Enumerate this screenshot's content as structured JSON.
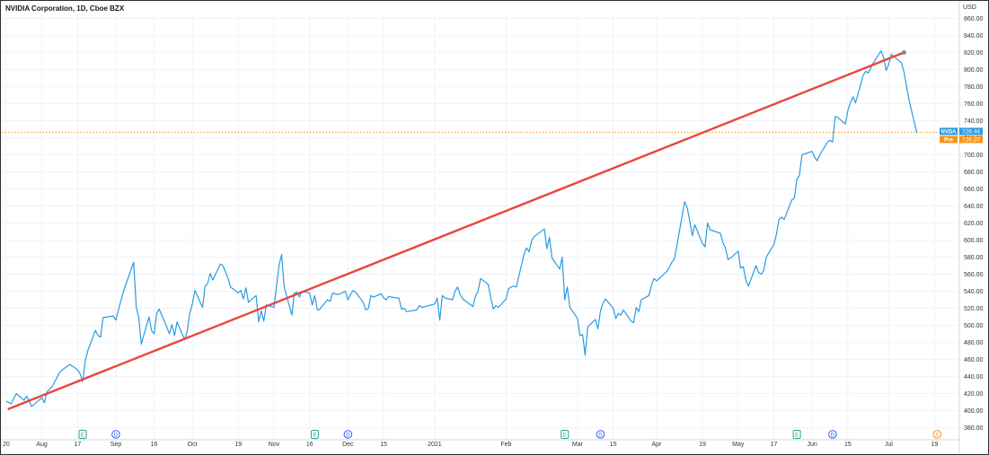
{
  "chart_title": "NVIDIA Corporation, 1D, Cboe BZX",
  "currency": "USD",
  "colors": {
    "price_line": "#2a9be0",
    "trend_line": "#e8453c",
    "last_tag": "#2a9be0",
    "pre_tag": "#f7931a",
    "hline": "#f7931a",
    "grid": "#f0f3f9"
  },
  "price_tags": [
    {
      "symbol": "NVDA",
      "value": "726.44"
    },
    {
      "symbol": "Pre",
      "value": "726.20"
    }
  ],
  "event_markers": [
    {
      "letter": "E",
      "color": "#26a69a",
      "date": "2020-08-19"
    },
    {
      "letter": "D",
      "color": "#2962ff",
      "date": "2020-09-01"
    },
    {
      "letter": "E",
      "color": "#26a69a",
      "date": "2020-11-18"
    },
    {
      "letter": "D",
      "color": "#2962ff",
      "date": "2020-12-01"
    },
    {
      "letter": "E",
      "color": "#26a69a",
      "date": "2021-02-24"
    },
    {
      "letter": "D",
      "color": "#2962ff",
      "date": "2021-03-10"
    },
    {
      "letter": "E",
      "color": "#26a69a",
      "date": "2021-05-26"
    },
    {
      "letter": "D",
      "color": "#2962ff",
      "date": "2021-06-09"
    },
    {
      "letter": "S",
      "color": "#f7931a",
      "date": "2021-07-20"
    }
  ],
  "chart_data": {
    "type": "line",
    "title": "NVIDIA Corporation, 1D, Cboe BZX",
    "ylabel": "USD",
    "ylim": [
      380,
      860
    ],
    "xlim": [
      "2020-07-19",
      "2021-07-28"
    ],
    "grid": true,
    "y_ticks": [
      "380.00",
      "400.00",
      "420.00",
      "440.00",
      "460.00",
      "480.00",
      "500.00",
      "520.00",
      "540.00",
      "560.00",
      "580.00",
      "600.00",
      "620.00",
      "640.00",
      "660.00",
      "680.00",
      "700.00",
      "720.00",
      "740.00",
      "760.00",
      "780.00",
      "800.00",
      "820.00",
      "840.00",
      "860.00"
    ],
    "x_ticks": [
      {
        "label": "20",
        "date": "2020-07-20"
      },
      {
        "label": "Aug",
        "date": "2020-08-03"
      },
      {
        "label": "17",
        "date": "2020-08-17"
      },
      {
        "label": "Sep",
        "date": "2020-09-01"
      },
      {
        "label": "16",
        "date": "2020-09-16"
      },
      {
        "label": "Oct",
        "date": "2020-10-01"
      },
      {
        "label": "19",
        "date": "2020-10-19"
      },
      {
        "label": "Nov",
        "date": "2020-11-02"
      },
      {
        "label": "16",
        "date": "2020-11-16"
      },
      {
        "label": "Dec",
        "date": "2020-12-01"
      },
      {
        "label": "15",
        "date": "2020-12-15"
      },
      {
        "label": "2021",
        "date": "2021-01-04"
      },
      {
        "label": "Feb",
        "date": "2021-02-01"
      },
      {
        "label": "Mar",
        "date": "2021-03-01"
      },
      {
        "label": "15",
        "date": "2021-03-15"
      },
      {
        "label": "Apr",
        "date": "2021-04-01"
      },
      {
        "label": "19",
        "date": "2021-04-19"
      },
      {
        "label": "May",
        "date": "2021-05-03"
      },
      {
        "label": "17",
        "date": "2021-05-17"
      },
      {
        "label": "Jun",
        "date": "2021-06-01"
      },
      {
        "label": "15",
        "date": "2021-06-15"
      },
      {
        "label": "Jul",
        "date": "2021-07-01"
      },
      {
        "label": "19",
        "date": "2021-07-19"
      }
    ],
    "series": [
      {
        "values": [
          [
            "2020-07-20",
            411
          ],
          [
            "2020-07-22",
            408
          ],
          [
            "2020-07-24",
            420
          ],
          [
            "2020-07-27",
            412
          ],
          [
            "2020-07-28",
            417
          ],
          [
            "2020-07-30",
            405
          ],
          [
            "2020-08-03",
            415
          ],
          [
            "2020-08-04",
            409
          ],
          [
            "2020-08-05",
            422
          ],
          [
            "2020-08-07",
            428
          ],
          [
            "2020-08-10",
            445
          ],
          [
            "2020-08-12",
            450
          ],
          [
            "2020-08-14",
            454
          ],
          [
            "2020-08-17",
            448
          ],
          [
            "2020-08-18",
            443
          ],
          [
            "2020-08-19",
            434
          ],
          [
            "2020-08-20",
            458
          ],
          [
            "2020-08-21",
            470
          ],
          [
            "2020-08-24",
            494
          ],
          [
            "2020-08-25",
            488
          ],
          [
            "2020-08-26",
            486
          ],
          [
            "2020-08-27",
            509
          ],
          [
            "2020-08-31",
            511
          ],
          [
            "2020-09-01",
            506
          ],
          [
            "2020-09-03",
            529
          ],
          [
            "2020-09-04",
            540
          ],
          [
            "2020-09-08",
            574
          ],
          [
            "2020-09-09",
            521
          ],
          [
            "2020-09-10",
            509
          ],
          [
            "2020-09-11",
            478
          ],
          [
            "2020-09-14",
            510
          ],
          [
            "2020-09-15",
            494
          ],
          [
            "2020-09-16",
            490
          ],
          [
            "2020-09-17",
            514
          ],
          [
            "2020-09-18",
            519
          ],
          [
            "2020-09-21",
            498
          ],
          [
            "2020-09-22",
            490
          ],
          [
            "2020-09-23",
            501
          ],
          [
            "2020-09-24",
            488
          ],
          [
            "2020-09-25",
            504
          ],
          [
            "2020-09-28",
            483
          ],
          [
            "2020-09-29",
            493
          ],
          [
            "2020-09-30",
            514
          ],
          [
            "2020-10-01",
            525
          ],
          [
            "2020-10-02",
            541
          ],
          [
            "2020-10-05",
            521
          ],
          [
            "2020-10-06",
            546
          ],
          [
            "2020-10-07",
            549
          ],
          [
            "2020-10-08",
            561
          ],
          [
            "2020-10-09",
            553
          ],
          [
            "2020-10-12",
            572
          ],
          [
            "2020-10-13",
            570
          ],
          [
            "2020-10-14",
            563
          ],
          [
            "2020-10-15",
            555
          ],
          [
            "2020-10-16",
            545
          ],
          [
            "2020-10-19",
            538
          ],
          [
            "2020-10-20",
            541
          ],
          [
            "2020-10-21",
            531
          ],
          [
            "2020-10-22",
            544
          ],
          [
            "2020-10-23",
            527
          ],
          [
            "2020-10-26",
            535
          ],
          [
            "2020-10-27",
            504
          ],
          [
            "2020-10-28",
            517
          ],
          [
            "2020-10-29",
            505
          ],
          [
            "2020-10-30",
            524
          ],
          [
            "2020-11-02",
            521
          ],
          [
            "2020-11-04",
            571
          ],
          [
            "2020-11-05",
            583
          ],
          [
            "2020-11-06",
            545
          ],
          [
            "2020-11-09",
            512
          ],
          [
            "2020-11-10",
            538
          ],
          [
            "2020-11-11",
            539
          ],
          [
            "2020-11-12",
            533
          ],
          [
            "2020-11-13",
            540
          ],
          [
            "2020-11-16",
            538
          ],
          [
            "2020-11-17",
            524
          ],
          [
            "2020-11-18",
            535
          ],
          [
            "2020-11-19",
            518
          ],
          [
            "2020-11-20",
            519
          ],
          [
            "2020-11-23",
            530
          ],
          [
            "2020-11-24",
            528
          ],
          [
            "2020-11-25",
            538
          ],
          [
            "2020-11-27",
            536
          ],
          [
            "2020-11-30",
            540
          ],
          [
            "2020-12-01",
            530
          ],
          [
            "2020-12-02",
            536
          ],
          [
            "2020-12-03",
            541
          ],
          [
            "2020-12-04",
            539
          ],
          [
            "2020-12-07",
            527
          ],
          [
            "2020-12-08",
            518
          ],
          [
            "2020-12-09",
            520
          ],
          [
            "2020-12-10",
            535
          ],
          [
            "2020-12-11",
            533
          ],
          [
            "2020-12-14",
            537
          ],
          [
            "2020-12-15",
            532
          ],
          [
            "2020-12-16",
            530
          ],
          [
            "2020-12-17",
            534
          ],
          [
            "2020-12-18",
            533
          ],
          [
            "2020-12-21",
            532
          ],
          [
            "2020-12-22",
            519
          ],
          [
            "2020-12-23",
            520
          ],
          [
            "2020-12-24",
            516
          ],
          [
            "2020-12-28",
            518
          ],
          [
            "2020-12-29",
            523
          ],
          [
            "2020-12-30",
            521
          ],
          [
            "2021-01-04",
            525
          ],
          [
            "2021-01-05",
            532
          ],
          [
            "2021-01-06",
            506
          ],
          [
            "2021-01-07",
            535
          ],
          [
            "2021-01-08",
            532
          ],
          [
            "2021-01-11",
            530
          ],
          [
            "2021-01-12",
            540
          ],
          [
            "2021-01-13",
            545
          ],
          [
            "2021-01-14",
            536
          ],
          [
            "2021-01-15",
            531
          ],
          [
            "2021-01-19",
            522
          ],
          [
            "2021-01-20",
            534
          ],
          [
            "2021-01-21",
            540
          ],
          [
            "2021-01-22",
            555
          ],
          [
            "2021-01-25",
            548
          ],
          [
            "2021-01-26",
            532
          ],
          [
            "2021-01-27",
            519
          ],
          [
            "2021-01-28",
            523
          ],
          [
            "2021-01-29",
            521
          ],
          [
            "2021-02-01",
            531
          ],
          [
            "2021-02-02",
            543
          ],
          [
            "2021-02-03",
            545
          ],
          [
            "2021-02-04",
            546
          ],
          [
            "2021-02-05",
            545
          ],
          [
            "2021-02-08",
            583
          ],
          [
            "2021-02-09",
            591
          ],
          [
            "2021-02-10",
            586
          ],
          [
            "2021-02-11",
            599
          ],
          [
            "2021-02-12",
            604
          ],
          [
            "2021-02-16",
            613
          ],
          [
            "2021-02-17",
            590
          ],
          [
            "2021-02-18",
            603
          ],
          [
            "2021-02-19",
            579
          ],
          [
            "2021-02-22",
            566
          ],
          [
            "2021-02-23",
            580
          ],
          [
            "2021-02-24",
            530
          ],
          [
            "2021-02-25",
            545
          ],
          [
            "2021-02-26",
            521
          ],
          [
            "2021-03-01",
            508
          ],
          [
            "2021-03-02",
            488
          ],
          [
            "2021-03-03",
            489
          ],
          [
            "2021-03-04",
            465
          ],
          [
            "2021-03-05",
            498
          ],
          [
            "2021-03-08",
            507
          ],
          [
            "2021-03-09",
            496
          ],
          [
            "2021-03-10",
            517
          ],
          [
            "2021-03-11",
            526
          ],
          [
            "2021-03-12",
            531
          ],
          [
            "2021-03-15",
            520
          ],
          [
            "2021-03-16",
            508
          ],
          [
            "2021-03-17",
            514
          ],
          [
            "2021-03-18",
            512
          ],
          [
            "2021-03-19",
            518
          ],
          [
            "2021-03-22",
            505
          ],
          [
            "2021-03-23",
            503
          ],
          [
            "2021-03-24",
            521
          ],
          [
            "2021-03-25",
            516
          ],
          [
            "2021-03-26",
            530
          ],
          [
            "2021-03-29",
            535
          ],
          [
            "2021-03-30",
            547
          ],
          [
            "2021-03-31",
            555
          ],
          [
            "2021-04-01",
            552
          ],
          [
            "2021-04-05",
            563
          ],
          [
            "2021-04-06",
            568
          ],
          [
            "2021-04-07",
            574
          ],
          [
            "2021-04-08",
            578
          ],
          [
            "2021-04-09",
            594
          ],
          [
            "2021-04-12",
            645
          ],
          [
            "2021-04-13",
            638
          ],
          [
            "2021-04-14",
            623
          ],
          [
            "2021-04-15",
            605
          ],
          [
            "2021-04-16",
            618
          ],
          [
            "2021-04-19",
            596
          ],
          [
            "2021-04-20",
            592
          ],
          [
            "2021-04-21",
            620
          ],
          [
            "2021-04-22",
            612
          ],
          [
            "2021-04-23",
            611
          ],
          [
            "2021-04-26",
            608
          ],
          [
            "2021-04-27",
            597
          ],
          [
            "2021-04-28",
            591
          ],
          [
            "2021-04-29",
            577
          ],
          [
            "2021-04-30",
            579
          ],
          [
            "2021-05-03",
            587
          ],
          [
            "2021-05-04",
            567
          ],
          [
            "2021-05-05",
            569
          ],
          [
            "2021-05-06",
            553
          ],
          [
            "2021-05-07",
            546
          ],
          [
            "2021-05-10",
            570
          ],
          [
            "2021-05-11",
            562
          ],
          [
            "2021-05-12",
            560
          ],
          [
            "2021-05-13",
            564
          ],
          [
            "2021-05-14",
            580
          ],
          [
            "2021-05-17",
            595
          ],
          [
            "2021-05-18",
            607
          ],
          [
            "2021-05-19",
            624
          ],
          [
            "2021-05-20",
            627
          ],
          [
            "2021-05-21",
            624
          ],
          [
            "2021-05-24",
            647
          ],
          [
            "2021-05-25",
            649
          ],
          [
            "2021-05-26",
            671
          ],
          [
            "2021-05-27",
            676
          ],
          [
            "2021-05-28",
            700
          ],
          [
            "2021-06-01",
            704
          ],
          [
            "2021-06-02",
            697
          ],
          [
            "2021-06-03",
            693
          ],
          [
            "2021-06-04",
            700
          ],
          [
            "2021-06-07",
            715
          ],
          [
            "2021-06-08",
            717
          ],
          [
            "2021-06-09",
            715
          ],
          [
            "2021-06-10",
            745
          ],
          [
            "2021-06-11",
            744
          ],
          [
            "2021-06-14",
            736
          ],
          [
            "2021-06-15",
            752
          ],
          [
            "2021-06-16",
            761
          ],
          [
            "2021-06-17",
            768
          ],
          [
            "2021-06-18",
            761
          ],
          [
            "2021-06-21",
            793
          ],
          [
            "2021-06-22",
            798
          ],
          [
            "2021-06-23",
            796
          ],
          [
            "2021-06-24",
            802
          ],
          [
            "2021-06-25",
            808
          ],
          [
            "2021-06-28",
            822
          ],
          [
            "2021-06-29",
            814
          ],
          [
            "2021-06-30",
            799
          ],
          [
            "2021-07-01",
            806
          ],
          [
            "2021-07-02",
            818
          ],
          [
            "2021-07-06",
            808
          ],
          [
            "2021-07-07",
            797
          ],
          [
            "2021-07-09",
            764
          ],
          [
            "2021-07-12",
            726
          ]
        ]
      }
    ],
    "trendline": {
      "from": [
        "2020-07-21",
        402
      ],
      "to": [
        "2021-07-07",
        820
      ]
    },
    "last_price_line": 726.44
  }
}
